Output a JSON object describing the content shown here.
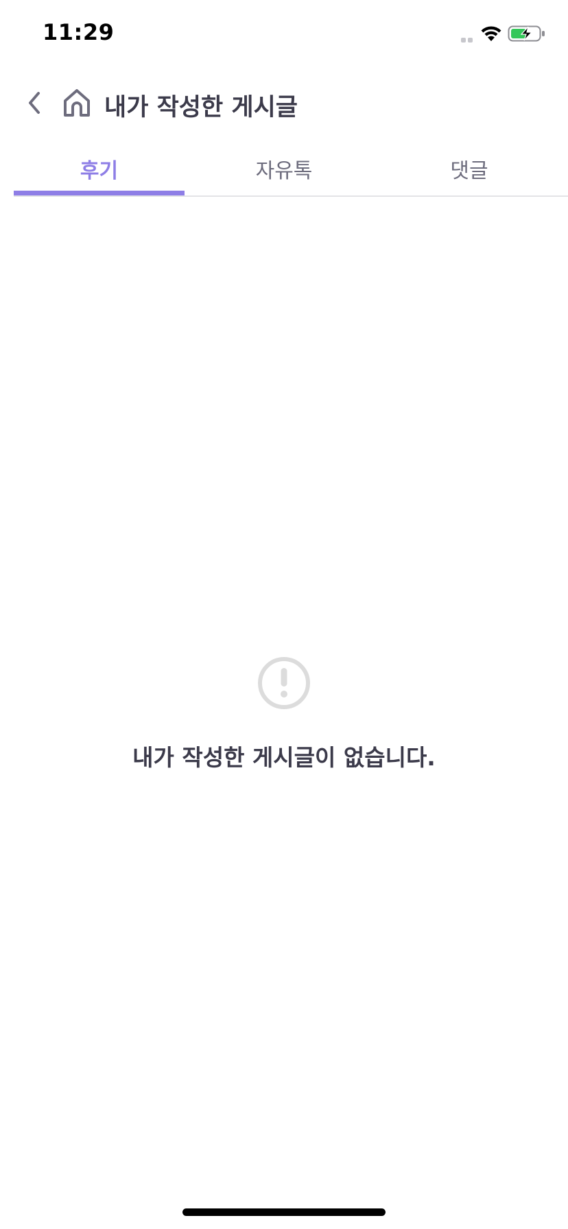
{
  "status_bar": {
    "time": "11:29"
  },
  "header": {
    "title": "내가 작성한 게시글",
    "back_icon": "chevron-left-icon",
    "home_icon": "home-icon"
  },
  "tabs": [
    {
      "label": "후기",
      "active": true
    },
    {
      "label": "자유톡",
      "active": false
    },
    {
      "label": "댓글",
      "active": false
    }
  ],
  "empty_state": {
    "icon": "exclamation-circle-icon",
    "message": "내가 작성한 게시글이 없습니다."
  },
  "colors": {
    "accent": "#8e7ee6",
    "title_text": "#3b3a4a",
    "inactive_tab": "#6d6c7d",
    "divider": "#e3e3e6",
    "empty_icon": "#dcdcdc",
    "battery_fill": "#34c759"
  }
}
